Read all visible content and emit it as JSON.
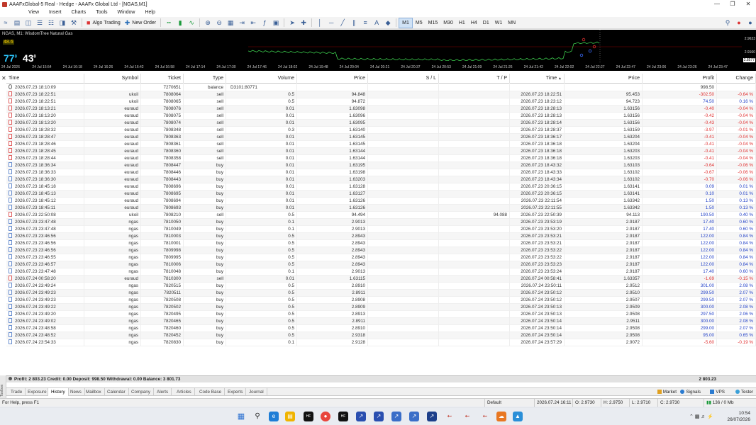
{
  "window": {
    "title": "AAAFxGlobal-5 Real - Hedge - AAAFx Global Ltd - [NGAS,M1]"
  },
  "menu": [
    "View",
    "Insert",
    "Charts",
    "Tools",
    "Window",
    "Help"
  ],
  "toolbar": {
    "algo_trading": "Algo Trading",
    "new_order": "New Order",
    "timeframes": [
      "M1",
      "M5",
      "M15",
      "M30",
      "H1",
      "H4",
      "D1",
      "W1",
      "MN"
    ],
    "active_timeframe": "M1"
  },
  "chart": {
    "title": "NGAS, M1: WisdomTree Natural Gas",
    "ask_small": "48.6",
    "bid_main": "77",
    "bid_sup": "0",
    "bid_tail": "43",
    "bid_tail_sup": "0",
    "price_labels": [
      "2.9633",
      "2.9160",
      "2.8577"
    ],
    "time_ticks": [
      "24 Jul 2026",
      "24 Jul 15:54",
      "24 Jul 16:18",
      "24 Jul 16:26",
      "24 Jul 16:42",
      "24 Jul 16:58",
      "24 Jul 17:14",
      "24 Jul 17:30",
      "24 Jul 17:46",
      "24 Jul 18:02",
      "24 Jul 19:48",
      "24 Jul 20:04",
      "24 Jul 20:21",
      "24 Jul 20:37",
      "24 Jul 20:53",
      "24 Jul 21:09",
      "24 Jul 21:26",
      "24 Jul 21:42",
      "24 Jul 22:02",
      "24 Jul 22:27",
      "24 Jul 22:47",
      "24 Jul 23:06",
      "24 Jul 23:26",
      "24 Jul 23:47"
    ]
  },
  "table": {
    "headers": {
      "time": "Time",
      "symbol": "Symbol",
      "ticket": "Ticket",
      "type": "Type",
      "volume": "Volume",
      "price": "Price",
      "sl": "S / L",
      "tp": "T / P",
      "close_time": "Time",
      "close_price": "Price",
      "profit": "Profit",
      "change": "Change"
    },
    "rows": [
      {
        "time": "2026.07.23 18:10:09",
        "symbol": "",
        "ticket": "7270651",
        "type": "balance",
        "volume": "D3101:80771",
        "price": "",
        "sl": "",
        "tp": "",
        "close_time": "",
        "close_price": "",
        "profit": "998.50",
        "change": ""
      },
      {
        "time": "2026.07.23 18:22:51",
        "symbol": "ukoil",
        "ticket": "7808064",
        "type": "sell",
        "volume": "0.5",
        "price": "94.848",
        "sl": "",
        "tp": "",
        "close_time": "2026.07.23 18:22:51",
        "close_price": "95.453",
        "profit": "-302.50",
        "change": "-0.64 %"
      },
      {
        "time": "2026.07.23 18:22:51",
        "symbol": "ukoil",
        "ticket": "7808065",
        "type": "sell",
        "volume": "0.5",
        "price": "94.872",
        "sl": "",
        "tp": "",
        "close_time": "2026.07.23 18:23:12",
        "close_price": "94.723",
        "profit": "74.50",
        "change": "0.16 %"
      },
      {
        "time": "2026.07.23 18:13:21",
        "symbol": "euraud",
        "ticket": "7808076",
        "type": "sell",
        "volume": "0.01",
        "price": "1.63098",
        "sl": "",
        "tp": "",
        "close_time": "2026.07.23 18:28:13",
        "close_price": "1.63156",
        "profit": "-0.40",
        "change": "-0.04 %"
      },
      {
        "time": "2026.07.23 18:13:20",
        "symbol": "euraud",
        "ticket": "7808075",
        "type": "sell",
        "volume": "0.01",
        "price": "1.63096",
        "sl": "",
        "tp": "",
        "close_time": "2026.07.23 18:28:13",
        "close_price": "1.63156",
        "profit": "-0.42",
        "change": "-0.04 %"
      },
      {
        "time": "2026.07.23 18:13:20",
        "symbol": "euraud",
        "ticket": "7808074",
        "type": "sell",
        "volume": "0.01",
        "price": "1.63095",
        "sl": "",
        "tp": "",
        "close_time": "2026.07.23 18:28:14",
        "close_price": "1.63156",
        "profit": "-0.43",
        "change": "-0.04 %"
      },
      {
        "time": "2026.07.23 18:28:32",
        "symbol": "euraud",
        "ticket": "7808348",
        "type": "sell",
        "volume": "0.3",
        "price": "1.63140",
        "sl": "",
        "tp": "",
        "close_time": "2026.07.23 18:28:37",
        "close_price": "1.63159",
        "profit": "-3.97",
        "change": "-0.01 %"
      },
      {
        "time": "2026.07.23 18:28:47",
        "symbol": "euraud",
        "ticket": "7808363",
        "type": "sell",
        "volume": "0.01",
        "price": "1.63145",
        "sl": "",
        "tp": "",
        "close_time": "2026.07.23 18:36:17",
        "close_price": "1.63204",
        "profit": "-0.41",
        "change": "-0.04 %"
      },
      {
        "time": "2026.07.23 18:28:46",
        "symbol": "euraud",
        "ticket": "7808361",
        "type": "sell",
        "volume": "0.01",
        "price": "1.63145",
        "sl": "",
        "tp": "",
        "close_time": "2026.07.23 18:36:18",
        "close_price": "1.63204",
        "profit": "-0.41",
        "change": "-0.04 %"
      },
      {
        "time": "2026.07.23 18:28:45",
        "symbol": "euraud",
        "ticket": "7808360",
        "type": "sell",
        "volume": "0.01",
        "price": "1.63144",
        "sl": "",
        "tp": "",
        "close_time": "2026.07.23 18:36:18",
        "close_price": "1.63203",
        "profit": "-0.41",
        "change": "-0.04 %"
      },
      {
        "time": "2026.07.23 18:28:44",
        "symbol": "euraud",
        "ticket": "7808358",
        "type": "sell",
        "volume": "0.01",
        "price": "1.63144",
        "sl": "",
        "tp": "",
        "close_time": "2026.07.23 18:36:18",
        "close_price": "1.63203",
        "profit": "-0.41",
        "change": "-0.04 %"
      },
      {
        "time": "2026.07.23 18:36:34",
        "symbol": "euraud",
        "ticket": "7808447",
        "type": "buy",
        "volume": "0.01",
        "price": "1.63195",
        "sl": "",
        "tp": "",
        "close_time": "2026.07.23 18:43:32",
        "close_price": "1.63103",
        "profit": "-0.64",
        "change": "-0.06 %"
      },
      {
        "time": "2026.07.23 18:36:33",
        "symbol": "euraud",
        "ticket": "7808446",
        "type": "buy",
        "volume": "0.01",
        "price": "1.63198",
        "sl": "",
        "tp": "",
        "close_time": "2026.07.23 18:43:33",
        "close_price": "1.63102",
        "profit": "-0.67",
        "change": "-0.06 %"
      },
      {
        "time": "2026.07.23 18:36:30",
        "symbol": "euraud",
        "ticket": "7808443",
        "type": "buy",
        "volume": "0.01",
        "price": "1.63203",
        "sl": "",
        "tp": "",
        "close_time": "2026.07.23 18:43:34",
        "close_price": "1.63102",
        "profit": "-0.70",
        "change": "-0.06 %"
      },
      {
        "time": "2026.07.23 18:45:18",
        "symbol": "euraud",
        "ticket": "7808696",
        "type": "buy",
        "volume": "0.01",
        "price": "1.63128",
        "sl": "",
        "tp": "",
        "close_time": "2026.07.23 20:36:15",
        "close_price": "1.63141",
        "profit": "0.09",
        "change": "0.01 %"
      },
      {
        "time": "2026.07.23 18:45:13",
        "symbol": "euraud",
        "ticket": "7808695",
        "type": "buy",
        "volume": "0.01",
        "price": "1.63127",
        "sl": "",
        "tp": "",
        "close_time": "2026.07.23 20:36:15",
        "close_price": "1.63141",
        "profit": "0.10",
        "change": "0.01 %"
      },
      {
        "time": "2026.07.23 18:45:12",
        "symbol": "euraud",
        "ticket": "7808694",
        "type": "buy",
        "volume": "0.01",
        "price": "1.63126",
        "sl": "",
        "tp": "",
        "close_time": "2026.07.23 22:11:54",
        "close_price": "1.63342",
        "profit": "1.50",
        "change": "0.13 %"
      },
      {
        "time": "2026.07.23 18:45:11",
        "symbol": "euraud",
        "ticket": "7808693",
        "type": "buy",
        "volume": "0.01",
        "price": "1.63126",
        "sl": "",
        "tp": "",
        "close_time": "2026.07.23 22:11:55",
        "close_price": "1.63342",
        "profit": "1.50",
        "change": "0.13 %"
      },
      {
        "time": "2026.07.23 22:50:08",
        "symbol": "ukoil",
        "ticket": "7808210",
        "type": "sell",
        "volume": "0.5",
        "price": "94.494",
        "sl": "",
        "tp": "94.088",
        "close_time": "2026.07.23 22:50:39",
        "close_price": "94.113",
        "profit": "190.50",
        "change": "0.40 %"
      },
      {
        "time": "2026.07.23 23:47:48",
        "symbol": "ngas",
        "ticket": "7810050",
        "type": "buy",
        "volume": "0.1",
        "price": "2.9013",
        "sl": "",
        "tp": "",
        "close_time": "2026.07.23 23:53:19",
        "close_price": "2.9187",
        "profit": "17.40",
        "change": "0.60 %"
      },
      {
        "time": "2026.07.23 23:47:48",
        "symbol": "ngas",
        "ticket": "7810049",
        "type": "buy",
        "volume": "0.1",
        "price": "2.9013",
        "sl": "",
        "tp": "",
        "close_time": "2026.07.23 23:53:20",
        "close_price": "2.9187",
        "profit": "17.40",
        "change": "0.60 %"
      },
      {
        "time": "2026.07.23 23:46:56",
        "symbol": "ngas",
        "ticket": "7810003",
        "type": "buy",
        "volume": "0.5",
        "price": "2.8943",
        "sl": "",
        "tp": "",
        "close_time": "2026.07.23 23:53:21",
        "close_price": "2.9187",
        "profit": "122.00",
        "change": "0.84 %"
      },
      {
        "time": "2026.07.23 23:46:56",
        "symbol": "ngas",
        "ticket": "7810001",
        "type": "buy",
        "volume": "0.5",
        "price": "2.8943",
        "sl": "",
        "tp": "",
        "close_time": "2026.07.23 23:53:21",
        "close_price": "2.9187",
        "profit": "122.00",
        "change": "0.84 %"
      },
      {
        "time": "2026.07.23 23:46:56",
        "symbol": "ngas",
        "ticket": "7809998",
        "type": "buy",
        "volume": "0.5",
        "price": "2.8943",
        "sl": "",
        "tp": "",
        "close_time": "2026.07.23 23:53:22",
        "close_price": "2.9187",
        "profit": "122.00",
        "change": "0.84 %"
      },
      {
        "time": "2026.07.23 23:46:55",
        "symbol": "ngas",
        "ticket": "7809995",
        "type": "buy",
        "volume": "0.5",
        "price": "2.8943",
        "sl": "",
        "tp": "",
        "close_time": "2026.07.23 23:53:22",
        "close_price": "2.9187",
        "profit": "122.00",
        "change": "0.84 %"
      },
      {
        "time": "2026.07.23 23:46:57",
        "symbol": "ngas",
        "ticket": "7810006",
        "type": "buy",
        "volume": "0.5",
        "price": "2.8943",
        "sl": "",
        "tp": "",
        "close_time": "2026.07.23 23:53:23",
        "close_price": "2.9187",
        "profit": "122.00",
        "change": "0.84 %"
      },
      {
        "time": "2026.07.23 23:47:48",
        "symbol": "ngas",
        "ticket": "7810048",
        "type": "buy",
        "volume": "0.1",
        "price": "2.9013",
        "sl": "",
        "tp": "",
        "close_time": "2026.07.23 23:53:24",
        "close_price": "2.9187",
        "profit": "17.40",
        "change": "0.60 %"
      },
      {
        "time": "2026.07.24 00:58:20",
        "symbol": "euraud",
        "ticket": "7810300",
        "type": "sell",
        "volume": "0.01",
        "price": "1.63115",
        "sl": "",
        "tp": "",
        "close_time": "2026.07.24 00:58:41",
        "close_price": "1.63357",
        "profit": "-1.69",
        "change": "-0.15 %"
      },
      {
        "time": "2026.07.24 23:49:24",
        "symbol": "ngas",
        "ticket": "7820515",
        "type": "buy",
        "volume": "0.5",
        "price": "2.8910",
        "sl": "",
        "tp": "",
        "close_time": "2026.07.24 23:50:11",
        "close_price": "2.9512",
        "profit": "301.00",
        "change": "2.08 %"
      },
      {
        "time": "2026.07.24 23:49:23",
        "symbol": "ngas",
        "ticket": "7820511",
        "type": "buy",
        "volume": "0.5",
        "price": "2.8911",
        "sl": "",
        "tp": "",
        "close_time": "2026.07.24 23:50:12",
        "close_price": "2.9510",
        "profit": "299.50",
        "change": "2.07 %"
      },
      {
        "time": "2026.07.24 23:49:23",
        "symbol": "ngas",
        "ticket": "7820508",
        "type": "buy",
        "volume": "0.5",
        "price": "2.8908",
        "sl": "",
        "tp": "",
        "close_time": "2026.07.24 23:50:12",
        "close_price": "2.9507",
        "profit": "299.50",
        "change": "2.07 %"
      },
      {
        "time": "2026.07.24 23:49:22",
        "symbol": "ngas",
        "ticket": "7820502",
        "type": "buy",
        "volume": "0.5",
        "price": "2.8909",
        "sl": "",
        "tp": "",
        "close_time": "2026.07.24 23:50:13",
        "close_price": "2.9509",
        "profit": "300.00",
        "change": "2.08 %"
      },
      {
        "time": "2026.07.24 23:49:20",
        "symbol": "ngas",
        "ticket": "7820495",
        "type": "buy",
        "volume": "0.5",
        "price": "2.8913",
        "sl": "",
        "tp": "",
        "close_time": "2026.07.24 23:50:13",
        "close_price": "2.9508",
        "profit": "297.50",
        "change": "2.06 %"
      },
      {
        "time": "2026.07.24 23:49:02",
        "symbol": "ngas",
        "ticket": "7820465",
        "type": "buy",
        "volume": "0.5",
        "price": "2.8911",
        "sl": "",
        "tp": "",
        "close_time": "2026.07.24 23:50:14",
        "close_price": "2.9511",
        "profit": "300.00",
        "change": "2.08 %"
      },
      {
        "time": "2026.07.24 23:48:58",
        "symbol": "ngas",
        "ticket": "7820460",
        "type": "buy",
        "volume": "0.5",
        "price": "2.8910",
        "sl": "",
        "tp": "",
        "close_time": "2026.07.24 23:50:14",
        "close_price": "2.9508",
        "profit": "299.00",
        "change": "2.07 %"
      },
      {
        "time": "2026.07.24 23:48:52",
        "symbol": "ngas",
        "ticket": "7820452",
        "type": "buy",
        "volume": "0.5",
        "price": "2.9318",
        "sl": "",
        "tp": "",
        "close_time": "2026.07.24 23:50:14",
        "close_price": "2.9508",
        "profit": "95.00",
        "change": "0.65 %"
      },
      {
        "time": "2026.07.24 23:54:33",
        "symbol": "ngas",
        "ticket": "7820830",
        "type": "buy",
        "volume": "0.1",
        "price": "2.9128",
        "sl": "",
        "tp": "",
        "close_time": "2026.07.24 23:57:29",
        "close_price": "2.9072",
        "profit": "-5.60",
        "change": "-0.19 %"
      }
    ]
  },
  "summary": {
    "text": "Profit: 2 803.23  Credit: 0.00  Deposit: 998.50  Withdrawal: 0.00  Balance: 3 801.73",
    "total": "2 803.23"
  },
  "toolbox": {
    "label": "Toolbox",
    "tabs": [
      "Trade",
      "Exposure",
      "History",
      "News",
      "Mailbox",
      "Calendar",
      "Company",
      "Alerts",
      "Articles",
      "Code Base",
      "Experts",
      "Journal"
    ],
    "active": "History",
    "right": [
      "Market",
      "Signals",
      "VPS",
      "Tester"
    ]
  },
  "status": {
    "help": "For Help, press F1",
    "profile": "Default",
    "datetime": "2026.07.24 16:11",
    "o": "O: 2.9730",
    "h": "H: 2.9750",
    "l": "L: 2.9710",
    "c": "C: 2.9730",
    "traffic": "136 / 0 Mb"
  },
  "taskbar": {
    "time": "10:54",
    "date": "26/07/2026"
  }
}
